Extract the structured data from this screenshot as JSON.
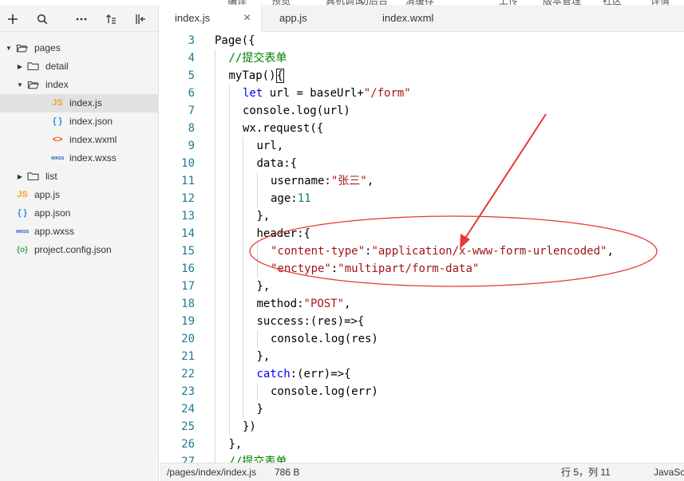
{
  "top_menu": [
    "编译",
    "预览",
    "真机调试",
    "切后台",
    "清缓存",
    "上传",
    "版本管理",
    "社区",
    "详情"
  ],
  "sidebar": {
    "toolbar": [
      {
        "icon": "plus-icon",
        "glyph": "+"
      },
      {
        "icon": "search-icon",
        "glyph": ""
      },
      {
        "icon": "more-icon",
        "glyph": "•••"
      },
      {
        "icon": "sort-icon",
        "glyph": ""
      },
      {
        "icon": "collapse-panel-icon",
        "glyph": ""
      }
    ],
    "tree": [
      {
        "label": "pages",
        "kind": "folder",
        "expanded": true,
        "depth": 0
      },
      {
        "label": "detail",
        "kind": "folder",
        "expanded": false,
        "depth": 1
      },
      {
        "label": "index",
        "kind": "folder",
        "expanded": true,
        "depth": 1
      },
      {
        "label": "index.js",
        "kind": "js",
        "icon_text": "JS",
        "depth": 2,
        "selected": true
      },
      {
        "label": "index.json",
        "kind": "json",
        "icon_text": "{ }",
        "depth": 2
      },
      {
        "label": "index.wxml",
        "kind": "wxml",
        "icon_text": "<>",
        "depth": 2
      },
      {
        "label": "index.wxss",
        "kind": "wxss",
        "icon_text": "wxss",
        "depth": 2
      },
      {
        "label": "list",
        "kind": "folder",
        "expanded": false,
        "depth": 1
      },
      {
        "label": "app.js",
        "kind": "js",
        "icon_text": "JS",
        "depth": 0
      },
      {
        "label": "app.json",
        "kind": "json",
        "icon_text": "{ }",
        "depth": 0
      },
      {
        "label": "app.wxss",
        "kind": "wxss",
        "icon_text": "wxss",
        "depth": 0
      },
      {
        "label": "project.config.json",
        "kind": "config",
        "icon_text": "{o}",
        "depth": 0
      }
    ]
  },
  "tabs": [
    {
      "label": "index.js",
      "active": true,
      "close": "×"
    },
    {
      "label": "app.js",
      "active": false
    },
    {
      "label": "index.wxml",
      "active": false
    }
  ],
  "editor": {
    "line_numbers": [
      "3",
      "4",
      "5",
      "6",
      "7",
      "8",
      "9",
      "10",
      "11",
      "12",
      "13",
      "14",
      "15",
      "16",
      "17",
      "18",
      "19",
      "20",
      "21",
      "22",
      "23",
      "24",
      "25",
      "26",
      "27"
    ],
    "lines": [
      {
        "indent": 0,
        "tokens": [
          [
            "prop",
            "Page({"
          ]
        ]
      },
      {
        "indent": 1,
        "tokens": [
          [
            "cm",
            "//提交表单"
          ]
        ]
      },
      {
        "indent": 1,
        "tokens": [
          [
            "prop",
            "myTap()"
          ],
          [
            "cursor",
            "{"
          ]
        ]
      },
      {
        "indent": 2,
        "tokens": [
          [
            "kw",
            "let"
          ],
          [
            "prop",
            " url = baseUrl+"
          ],
          [
            "str",
            "\"/form\""
          ]
        ]
      },
      {
        "indent": 2,
        "tokens": [
          [
            "prop",
            "console.log(url)"
          ]
        ]
      },
      {
        "indent": 2,
        "tokens": [
          [
            "prop",
            "wx.request({"
          ]
        ]
      },
      {
        "indent": 3,
        "tokens": [
          [
            "prop",
            "url,"
          ]
        ]
      },
      {
        "indent": 3,
        "tokens": [
          [
            "prop",
            "data:{"
          ]
        ]
      },
      {
        "indent": 4,
        "tokens": [
          [
            "prop",
            "username:"
          ],
          [
            "str",
            "\"张三\""
          ],
          [
            "prop",
            ","
          ]
        ]
      },
      {
        "indent": 4,
        "tokens": [
          [
            "prop",
            "age:"
          ],
          [
            "num",
            "11"
          ]
        ]
      },
      {
        "indent": 3,
        "tokens": [
          [
            "prop",
            "},"
          ]
        ]
      },
      {
        "indent": 3,
        "tokens": [
          [
            "prop",
            "header:{"
          ]
        ]
      },
      {
        "indent": 4,
        "tokens": [
          [
            "str",
            "\"content-type\""
          ],
          [
            "prop",
            ":"
          ],
          [
            "str",
            "\"application/x-www-form-urlencoded\""
          ],
          [
            "prop",
            ","
          ]
        ]
      },
      {
        "indent": 4,
        "tokens": [
          [
            "str",
            "\"enctype\""
          ],
          [
            "prop",
            ":"
          ],
          [
            "str",
            "\"multipart/form-data\""
          ]
        ]
      },
      {
        "indent": 3,
        "tokens": [
          [
            "prop",
            "},"
          ]
        ]
      },
      {
        "indent": 3,
        "tokens": [
          [
            "prop",
            "method:"
          ],
          [
            "str",
            "\"POST\""
          ],
          [
            "prop",
            ","
          ]
        ]
      },
      {
        "indent": 3,
        "tokens": [
          [
            "prop",
            "success:(res)=>{"
          ]
        ]
      },
      {
        "indent": 4,
        "tokens": [
          [
            "prop",
            "console.log(res)"
          ]
        ]
      },
      {
        "indent": 3,
        "tokens": [
          [
            "prop",
            "},"
          ]
        ]
      },
      {
        "indent": 3,
        "tokens": [
          [
            "kw",
            "catch"
          ],
          [
            "prop",
            ":(err)=>{"
          ]
        ]
      },
      {
        "indent": 4,
        "tokens": [
          [
            "prop",
            "console.log(err)"
          ]
        ]
      },
      {
        "indent": 3,
        "tokens": [
          [
            "prop",
            "}"
          ]
        ]
      },
      {
        "indent": 2,
        "tokens": [
          [
            "prop",
            "})"
          ]
        ]
      },
      {
        "indent": 1,
        "tokens": [
          [
            "prop",
            "},"
          ]
        ]
      },
      {
        "indent": 1,
        "tokens": [
          [
            "cm",
            "//提交表单"
          ]
        ]
      }
    ]
  },
  "statusbar": {
    "path": "/pages/index/index.js",
    "size": "786 B",
    "position": "行 5，列 11",
    "language": "JavaSc"
  },
  "colors": {
    "annotation": "#e53935",
    "keyword": "#0000ff",
    "string": "#a31515",
    "number": "#09885a",
    "comment": "#008000",
    "line_number": "#237893"
  }
}
